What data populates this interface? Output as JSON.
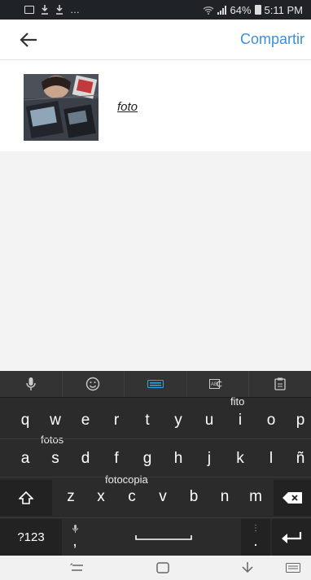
{
  "status_bar": {
    "left_indicators": [
      "…"
    ],
    "battery": "64%",
    "time": "5:11 PM"
  },
  "header": {
    "back_label": "",
    "share_label": "Compartir"
  },
  "post": {
    "caption": "foto"
  },
  "keyboard": {
    "suggestions": [
      "fito",
      "fotos",
      "fotocopia"
    ],
    "row1": [
      "q",
      "w",
      "e",
      "r",
      "t",
      "y",
      "u",
      "i",
      "o",
      "p"
    ],
    "row2": [
      "a",
      "s",
      "d",
      "f",
      "g",
      "h",
      "j",
      "k",
      "l",
      "ñ"
    ],
    "row3": [
      "z",
      "x",
      "c",
      "v",
      "b",
      "n",
      "m"
    ],
    "symbols_label": "?123",
    "comma": ",",
    "period": "."
  },
  "colors": {
    "accent": "#3d8fd6",
    "keyboard_bg": "#2b2b2b",
    "highlight": "#2aa6e8"
  }
}
